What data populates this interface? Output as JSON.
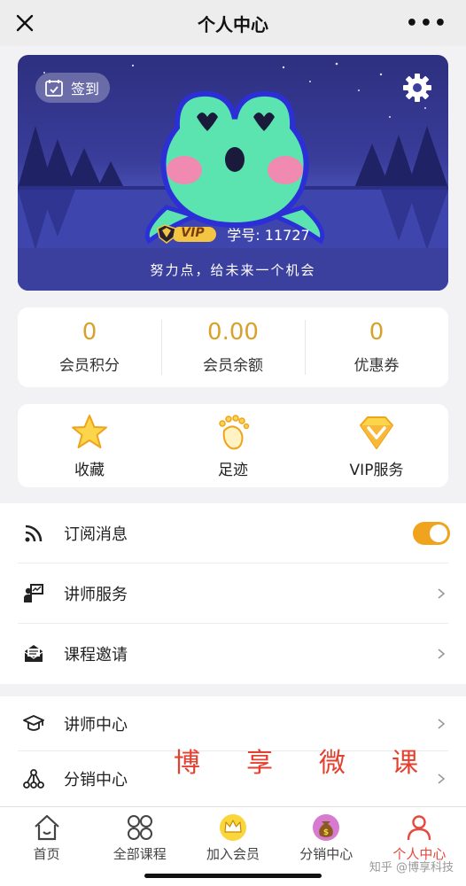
{
  "header": {
    "title": "个人中心",
    "more": "•••"
  },
  "hero": {
    "checkin_label": "签到",
    "vip_badge": "VIP",
    "student_id": "学号: 11727",
    "motto": "努力点，给未来一个机会"
  },
  "stats": [
    {
      "value": "0",
      "label": "会员积分"
    },
    {
      "value": "0.00",
      "label": "会员余额"
    },
    {
      "value": "0",
      "label": "优惠券"
    }
  ],
  "quick": [
    {
      "label": "收藏",
      "icon": "star-icon"
    },
    {
      "label": "足迹",
      "icon": "footprint-icon"
    },
    {
      "label": "VIP服务",
      "icon": "vip-diamond-icon"
    }
  ],
  "menu1": [
    {
      "label": "订阅消息",
      "icon": "rss-icon",
      "toggle_on": true
    },
    {
      "label": "讲师服务",
      "icon": "lecturer-service-icon"
    },
    {
      "label": "课程邀请",
      "icon": "mail-icon"
    }
  ],
  "menu2": [
    {
      "label": "讲师中心",
      "icon": "graduation-cap-icon"
    },
    {
      "label": "分销中心",
      "icon": "network-icon"
    }
  ],
  "watermark": [
    "博",
    "享",
    "微",
    "课"
  ],
  "tabs": [
    {
      "label": "首页",
      "icon": "home-icon"
    },
    {
      "label": "全部课程",
      "icon": "grid-icon"
    },
    {
      "label": "加入会员",
      "icon": "crown-icon"
    },
    {
      "label": "分销中心",
      "icon": "money-bag-icon"
    },
    {
      "label": "个人中心",
      "icon": "person-icon",
      "active": true
    }
  ],
  "credit": "知乎 @博享科技",
  "colors": {
    "accent": "#d9a12b",
    "active_tab": "#e5483f",
    "toggle": "#f0a31c",
    "hero": "#3a3d9a"
  }
}
